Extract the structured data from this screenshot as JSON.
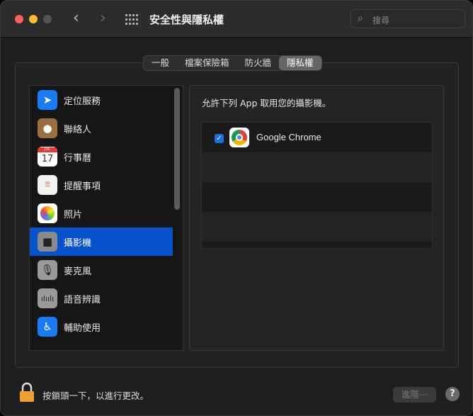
{
  "window": {
    "title": "安全性與隱私權",
    "search_placeholder": "搜尋"
  },
  "colors": {
    "accent": "#0651cc",
    "close": "#ff5f57",
    "minimize": "#febc2e",
    "zoom_disabled": "#555555"
  },
  "tabs": [
    {
      "label": "一般"
    },
    {
      "label": "檔案保險箱"
    },
    {
      "label": "防火牆"
    },
    {
      "label": "隱私權",
      "active": true
    }
  ],
  "sidebar": {
    "items": [
      {
        "label": "定位服務",
        "icon": "location-arrow-icon"
      },
      {
        "label": "聯絡人",
        "icon": "contacts-icon"
      },
      {
        "label": "行事曆",
        "icon": "calendar-icon",
        "month": "JUL",
        "day": "17"
      },
      {
        "label": "提醒事項",
        "icon": "reminders-icon"
      },
      {
        "label": "照片",
        "icon": "photos-icon"
      },
      {
        "label": "攝影機",
        "icon": "camera-icon",
        "selected": true
      },
      {
        "label": "麥克風",
        "icon": "microphone-icon"
      },
      {
        "label": "語音辨識",
        "icon": "speech-recognition-icon"
      },
      {
        "label": "輔助使用",
        "icon": "accessibility-icon"
      }
    ]
  },
  "main": {
    "heading": "允許下列 App 取用您的攝影機。",
    "apps": [
      {
        "name": "Google Chrome",
        "checked": true
      }
    ]
  },
  "footer": {
    "lock_hint": "按鎖頭一下，以進行更改。",
    "advanced_label": "進階⋯",
    "help_label": "?"
  }
}
